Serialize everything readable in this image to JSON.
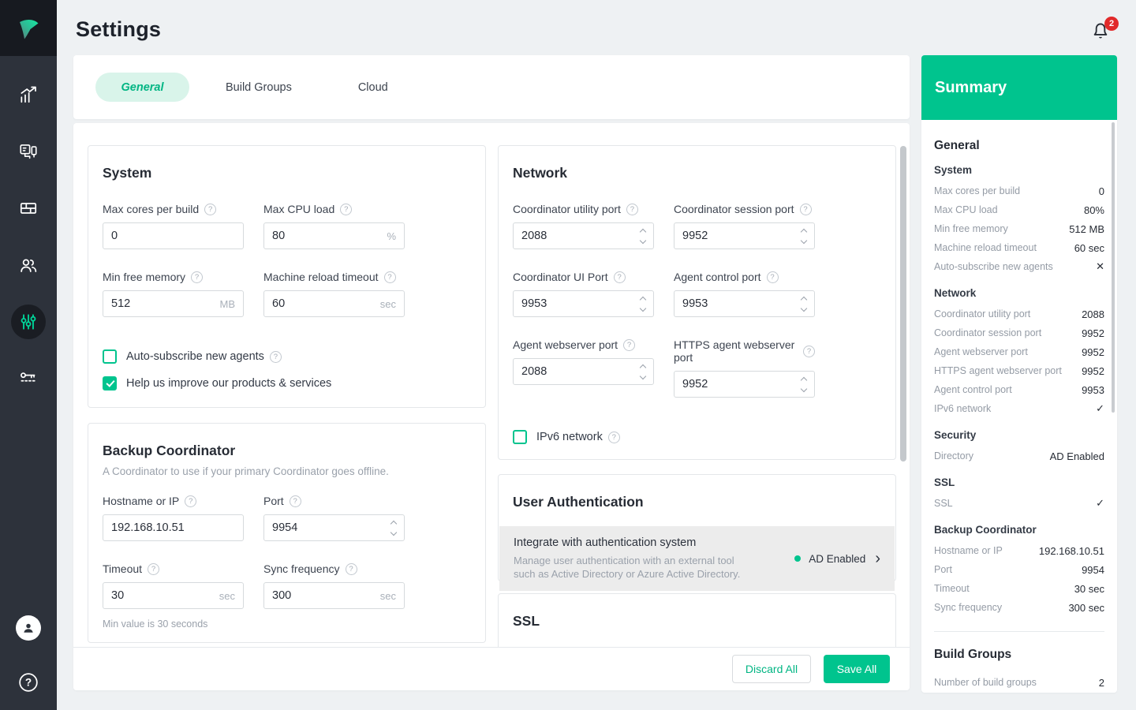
{
  "colors": {
    "accent": "#00c48e",
    "accent_light": "#d9f4ea",
    "badge_red": "#e12a2a"
  },
  "icons": {
    "help": "?",
    "check": "✓",
    "cross": "✕",
    "chevron_right": "›"
  },
  "header": {
    "title": "Settings",
    "notification_count": "2"
  },
  "tabs": {
    "general": "General",
    "build_groups": "Build Groups",
    "cloud": "Cloud"
  },
  "system": {
    "title": "System",
    "fields": [
      {
        "label": "Max cores per build",
        "value": "0"
      },
      {
        "label": "Max CPU load",
        "value": "80",
        "unit": "%"
      },
      {
        "label": "Min free memory",
        "value": "512",
        "unit": "MB"
      },
      {
        "label": "Machine reload timeout",
        "value": "60",
        "unit": "sec"
      }
    ],
    "checkboxes": [
      {
        "label": "Auto-subscribe new agents",
        "checked": false
      },
      {
        "label": "Help us improve our products & services",
        "checked": true
      }
    ]
  },
  "backup": {
    "title": "Backup Coordinator",
    "subtitle": "A Coordinator to use if your primary Coordinator goes offline.",
    "fields": [
      {
        "label": "Hostname or IP",
        "value": "192.168.10.51"
      },
      {
        "label": "Port",
        "value": "9954"
      },
      {
        "label": "Timeout",
        "value": "30",
        "unit": "sec"
      },
      {
        "label": "Sync frequency",
        "value": "300",
        "unit": "sec"
      }
    ],
    "hint": "Min value is 30 seconds"
  },
  "network": {
    "title": "Network",
    "fields": [
      {
        "label": "Coordinator utility port",
        "value": "2088"
      },
      {
        "label": "Coordinator session port",
        "value": "9952"
      },
      {
        "label": "Coordinator UI Port",
        "value": "9953"
      },
      {
        "label": "Agent control port",
        "value": "9953"
      },
      {
        "label": "Agent webserver port",
        "value": "2088"
      },
      {
        "label": "HTTPS agent webserver port",
        "value": "9952"
      }
    ],
    "checkbox": {
      "label": "IPv6 network",
      "checked": false
    }
  },
  "auth": {
    "title": "User Authentication",
    "row_title": "Integrate with authentication system",
    "desc_line1": "Manage user authentication with an external tool",
    "desc_line2": "such as Active Directory or Azure Active Directory.",
    "status": "AD Enabled"
  },
  "ssl_card": {
    "title": "SSL"
  },
  "footer": {
    "discard": "Discard All",
    "save": "Save All"
  },
  "summary": {
    "title": "Summary",
    "general_heading": "General",
    "groups": [
      {
        "heading": "System",
        "rows": [
          {
            "label": "Max cores per build",
            "value": "0"
          },
          {
            "label": "Max CPU load",
            "value": "80%"
          },
          {
            "label": "Min free memory",
            "value": "512 MB"
          },
          {
            "label": "Machine reload timeout",
            "value": "60 sec"
          },
          {
            "label": "Auto-subscribe new agents",
            "value": "✕"
          }
        ]
      },
      {
        "heading": "Network",
        "rows": [
          {
            "label": "Coordinator utility port",
            "value": "2088"
          },
          {
            "label": "Coordinator session port",
            "value": "9952"
          },
          {
            "label": "Agent webserver port",
            "value": "9952"
          },
          {
            "label": "HTTPS agent webserver port",
            "value": "9952"
          },
          {
            "label": "Agent control port",
            "value": "9953"
          },
          {
            "label": "IPv6 network",
            "value": "✓"
          }
        ]
      },
      {
        "heading": "Security",
        "rows": [
          {
            "label": "Directory",
            "value": "AD Enabled"
          }
        ]
      },
      {
        "heading": "SSL",
        "rows": [
          {
            "label": "SSL",
            "value": "✓"
          }
        ]
      },
      {
        "heading": "Backup Coordinator",
        "rows": [
          {
            "label": "Hostname or IP",
            "value": "192.168.10.51"
          },
          {
            "label": "Port",
            "value": "9954"
          },
          {
            "label": "Timeout",
            "value": "30 sec"
          },
          {
            "label": "Sync frequency",
            "value": "300 sec"
          }
        ]
      }
    ],
    "build_groups_heading": "Build Groups",
    "build_groups_row": {
      "label": "Number of build groups",
      "value": "2"
    }
  }
}
